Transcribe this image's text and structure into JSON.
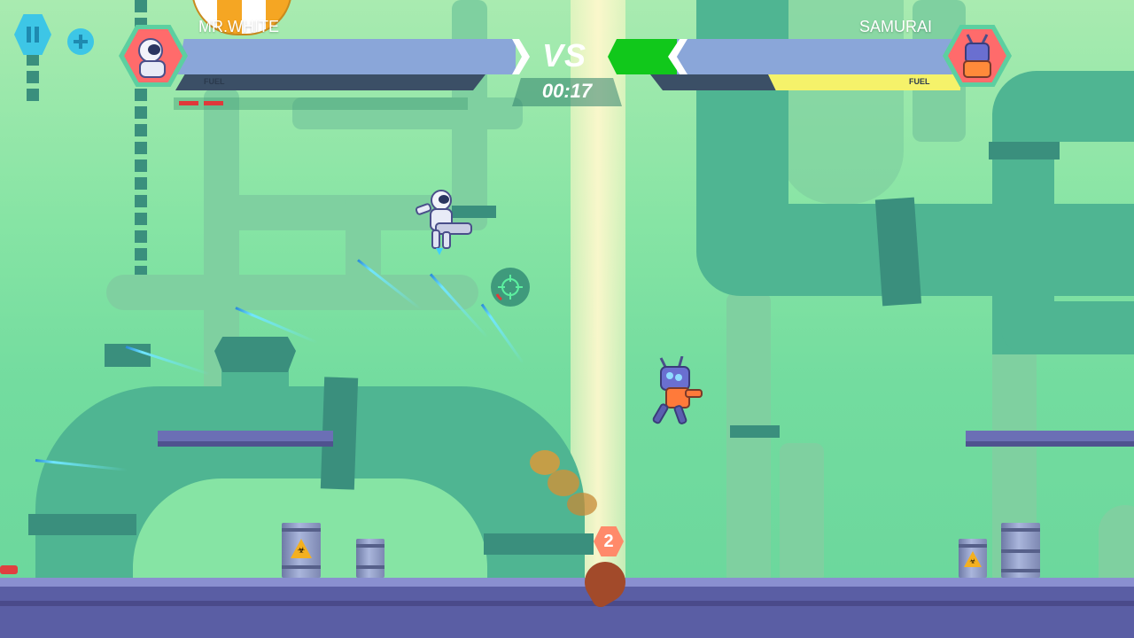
{
  "hud": {
    "player_left": {
      "name": "MR.WHITE",
      "fuel_label": "FUEL",
      "fuel_level": 0.0,
      "health": 1.0
    },
    "player_right": {
      "name": "SAMURAI",
      "fuel_label": "FUEL",
      "fuel_level": 0.62,
      "health": 1.0
    },
    "vs_label": "VS",
    "timer": "00:17"
  },
  "controls": {
    "pause_icon": "pause-icon",
    "add_icon": "plus-icon"
  },
  "world": {
    "pickup_counter": "2",
    "hazard_symbol": "☣",
    "crosshair_icon": "crosshair-icon"
  },
  "colors": {
    "background": "#86e4a4",
    "health_bar": "#8aa6d9",
    "fuel_yellow": "#f5f26a",
    "boost_green": "#11c81b",
    "hex_avatar": "#ff6b6b",
    "floor": "#5a5ea4"
  }
}
